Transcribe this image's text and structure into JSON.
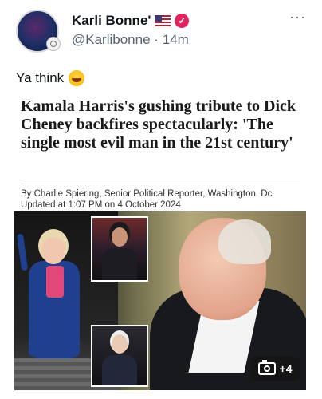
{
  "post": {
    "author": {
      "display_name": "Karli Bonne'",
      "handle": "@Karlibonne",
      "time_separator": "·",
      "time": "14m",
      "flag_icon": "us-flag-icon",
      "verified_icon": "verified-badge-icon",
      "verified_color": "#e0245e"
    },
    "more_icon": "···",
    "text": "Ya think",
    "emoji": "rolling-on-floor-laughing-emoji"
  },
  "article": {
    "headline": "Kamala Harris's gushing tribute to Dick Cheney backfires spectacularly: 'The single most evil man in the 21st century'",
    "byline": "By Charlie Spiering, Senior Political Reporter, Washington, Dc",
    "updated": "Updated at 1:07 PM on 4 October 2024"
  },
  "media": {
    "gallery_count": "+4",
    "gallery_icon": "camera-icon"
  }
}
